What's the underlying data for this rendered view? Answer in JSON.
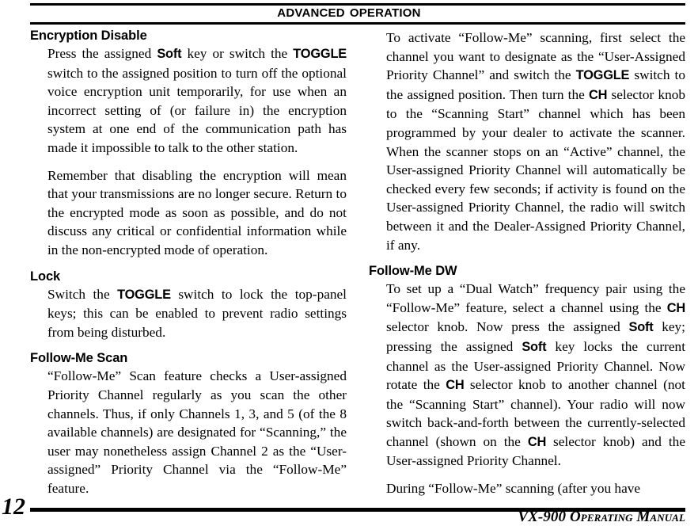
{
  "document": {
    "header_title": "Advanced Operation",
    "page_number": "12",
    "footer_title": "VX-900 Operating Manual"
  },
  "left_column": {
    "sections": [
      {
        "heading": "Encryption Disable",
        "paragraphs": [
          {
            "runs": [
              {
                "text": "Press the assigned ",
                "style": "normal"
              },
              {
                "text": "Soft",
                "style": "bold"
              },
              {
                "text": " key or switch the ",
                "style": "normal"
              },
              {
                "text": "TOGGLE",
                "style": "bold"
              },
              {
                "text": " switch to the assigned position to turn off the optional voice encryption unit temporarily, for use when an incorrect setting of (or failure in) the encryption system at one end of the communication path has made it impossible to talk to the other station.",
                "style": "normal"
              }
            ]
          },
          {
            "runs": [
              {
                "text": "Remember that disabling the encryption will mean that your transmissions are no longer secure. Return to the encrypted mode as soon as possible, and do not discuss any critical or confidential information while in the non-encrypted mode of operation.",
                "style": "normal"
              }
            ]
          }
        ]
      },
      {
        "heading": "Lock",
        "paragraphs": [
          {
            "runs": [
              {
                "text": "Switch the ",
                "style": "normal"
              },
              {
                "text": "TOGGLE",
                "style": "bold"
              },
              {
                "text": " switch to lock the top-panel keys; this can be enabled to prevent radio settings from being disturbed.",
                "style": "normal"
              }
            ]
          }
        ]
      },
      {
        "heading": "Follow-Me Scan",
        "paragraphs": [
          {
            "runs": [
              {
                "text": "“Follow-Me” Scan feature checks a User-assigned Priority Channel regularly as you scan the other channels. Thus, if only Channels 1, 3, and 5 (of the 8 available channels) are designated for “Scanning,” the user may nonetheless assign Channel 2 as the “User-assigned” Priority Channel via the “Follow-Me” feature.",
                "style": "normal"
              }
            ]
          }
        ]
      }
    ]
  },
  "right_column": {
    "sections": [
      {
        "heading": "",
        "paragraphs": [
          {
            "runs": [
              {
                "text": "To activate “Follow-Me” scanning, first select the channel you want to designate as the “User-Assigned Priority Channel” and switch the ",
                "style": "normal"
              },
              {
                "text": "TOGGLE",
                "style": "bold"
              },
              {
                "text": " switch to the assigned position. Then turn the ",
                "style": "normal"
              },
              {
                "text": "CH",
                "style": "bold"
              },
              {
                "text": " selector knob to the “Scanning Start” channel which has been programmed by your dealer to activate the scanner. When the scanner stops on an “Active” channel, the User-assigned Priority Channel will automatically be checked every few seconds; if activity is found on the User-assigned Priority Channel, the radio will switch between it and the Dealer-Assigned  Priority Channel, if any.",
                "style": "normal"
              }
            ]
          }
        ]
      },
      {
        "heading": "Follow-Me DW",
        "paragraphs": [
          {
            "runs": [
              {
                "text": "To set up a “Dual Watch” frequency pair using the “Follow-Me” feature, select a channel using the ",
                "style": "normal"
              },
              {
                "text": "CH",
                "style": "bold"
              },
              {
                "text": " selector knob. Now press the assigned ",
                "style": "normal"
              },
              {
                "text": "Soft",
                "style": "bold"
              },
              {
                "text": " key; pressing the assigned ",
                "style": "normal"
              },
              {
                "text": "Soft",
                "style": "bold"
              },
              {
                "text": " key locks the current channel as the User-assigned Priority Channel. Now rotate the ",
                "style": "normal"
              },
              {
                "text": "CH",
                "style": "bold"
              },
              {
                "text": " selector knob to another channel (not the “Scanning Start” channel). Your radio will now switch back-and-forth between the currently-selected channel (shown on the ",
                "style": "normal"
              },
              {
                "text": "CH",
                "style": "bold"
              },
              {
                "text": " selector knob) and the User-assigned Priority Channel.",
                "style": "normal"
              }
            ]
          },
          {
            "runs": [
              {
                "text": "During “Follow-Me” scanning (after you have",
                "style": "normal"
              }
            ]
          }
        ]
      }
    ]
  }
}
